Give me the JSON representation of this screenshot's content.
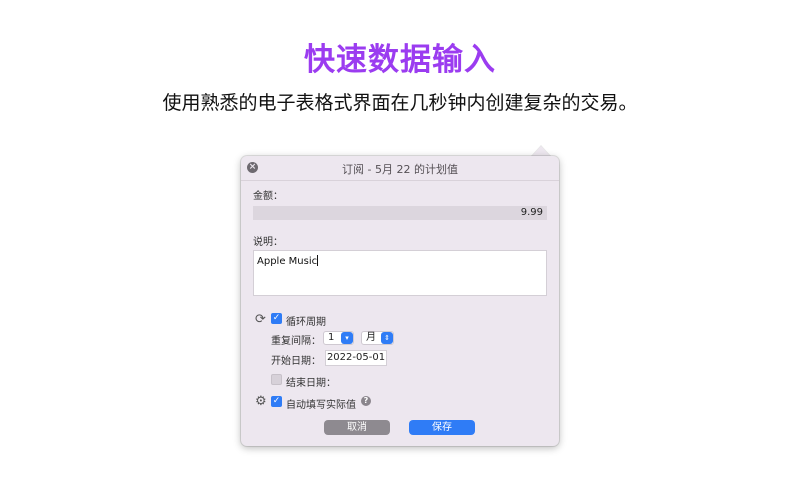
{
  "hero": {
    "title": "快速数据输入",
    "subtitle": "使用熟悉的电子表格式界面在几秒钟内创建复杂的交易。"
  },
  "window": {
    "title": "订阅 - 5月 22 的计划值"
  },
  "form": {
    "amount_label": "金额：",
    "amount_value": "9.99",
    "description_label": "说明：",
    "description_value": "Apple Music",
    "recurring_label": "循环周期",
    "interval_label": "重复间隔：",
    "interval_value": "1",
    "interval_unit": "月",
    "start_date_label": "开始日期：",
    "start_date_value": "2022-05-01",
    "end_date_label": "结束日期：",
    "autofill_label": "自动填写实际值"
  },
  "buttons": {
    "cancel_label": "取消",
    "save_label": "保存"
  },
  "icons": {
    "close": "close-icon",
    "recurring": "refresh-icon",
    "settings": "gear-icon",
    "help": "help-icon"
  },
  "colors": {
    "hero_title": "#9b3cf0",
    "accent": "#2f7cf6",
    "panel_bg": "#ede7ef"
  }
}
